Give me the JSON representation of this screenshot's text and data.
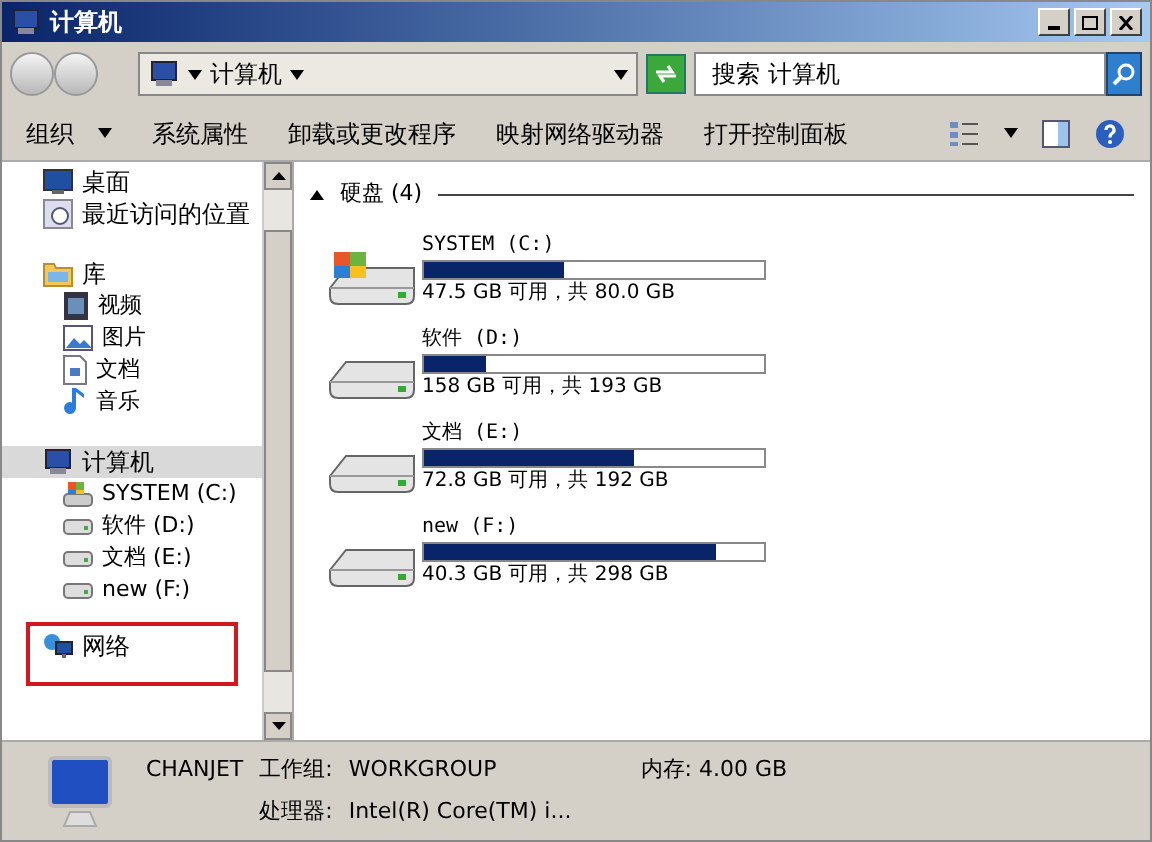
{
  "window": {
    "title": "计算机"
  },
  "address": {
    "crumb": "计算机"
  },
  "search": {
    "placeholder": "搜索 计算机"
  },
  "toolbar": {
    "buttons": [
      {
        "label": "组织",
        "menu": true
      },
      {
        "label": "系统属性",
        "menu": false
      },
      {
        "label": "卸载或更改程序",
        "menu": false
      },
      {
        "label": "映射网络驱动器",
        "menu": false
      },
      {
        "label": "打开控制面板",
        "menu": false
      }
    ]
  },
  "sidebar": {
    "groups": [
      {
        "label": "桌面",
        "kind": "desktop",
        "selected": false,
        "highlighted": false
      },
      {
        "label": "最近访问的位置",
        "kind": "recent",
        "selected": false,
        "highlighted": false
      },
      {
        "label": "库",
        "kind": "library",
        "selected": false,
        "highlighted": false,
        "children": [
          {
            "label": "视频",
            "kind": "video"
          },
          {
            "label": "图片",
            "kind": "picture"
          },
          {
            "label": "文档",
            "kind": "document"
          },
          {
            "label": "音乐",
            "kind": "music"
          }
        ]
      },
      {
        "label": "计算机",
        "kind": "computer",
        "selected": true,
        "highlighted": false,
        "children": [
          {
            "label": "SYSTEM (C:)",
            "kind": "system-drive"
          },
          {
            "label": "软件 (D:)",
            "kind": "drive"
          },
          {
            "label": "文档 (E:)",
            "kind": "drive"
          },
          {
            "label": "new (F:)",
            "kind": "drive"
          }
        ]
      },
      {
        "label": "网络",
        "kind": "network",
        "selected": false,
        "highlighted": true
      }
    ]
  },
  "content": {
    "group_header": "硬盘 (4)",
    "expanded": true,
    "drives": [
      {
        "name": "SYSTEM (C:)",
        "kind": "system-drive",
        "level": 0.41,
        "free": "47.5 GB 可用，共 80.0 GB"
      },
      {
        "name": "软件 (D:)",
        "kind": "drive",
        "level": 0.18,
        "free": "158 GB 可用，共 193 GB"
      },
      {
        "name": "文档 (E:)",
        "kind": "drive",
        "level": 0.62,
        "free": "72.8 GB 可用，共 192 GB"
      },
      {
        "name": "new (F:)",
        "kind": "drive",
        "level": 0.86,
        "free": "40.3 GB 可用，共 298 GB"
      }
    ]
  },
  "details": {
    "computer_name": "CHANJET",
    "workgroup_label": "工作组:",
    "workgroup": "WORKGROUP",
    "memory_label": "内存:",
    "memory": "4.00 GB",
    "processor_label": "处理器:",
    "processor": "Intel(R) Core(TM) i..."
  }
}
